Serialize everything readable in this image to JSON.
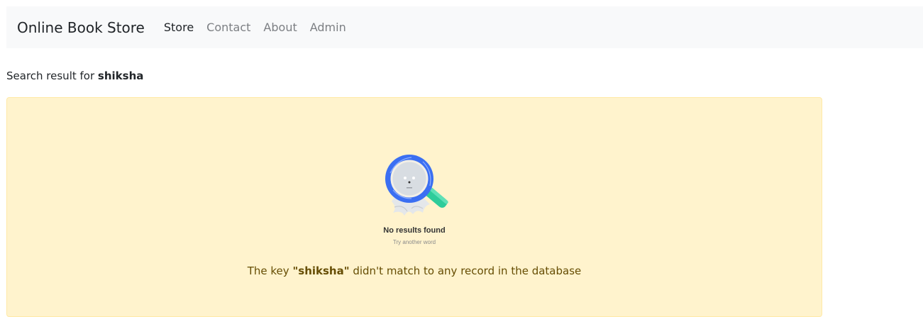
{
  "navbar": {
    "brand": "Online Book Store",
    "links": [
      {
        "label": "Store",
        "active": true
      },
      {
        "label": "Contact",
        "active": false
      },
      {
        "label": "About",
        "active": false
      },
      {
        "label": "Admin",
        "active": false
      }
    ]
  },
  "search": {
    "prefix": "Search result for",
    "query": "shiksha"
  },
  "empty_state": {
    "icon": "magnifier-empty-face-illustration",
    "title": "No results found",
    "subtitle": "Try another word"
  },
  "alert": {
    "prefix": "The key",
    "key_quoted": "\"shiksha\"",
    "suffix": "didn't match to any record in the database"
  },
  "colors": {
    "navbar_bg": "#f8f9fa",
    "alert_bg": "#fff3cd",
    "alert_text": "#664d03",
    "magnifier_ring": "#3b6ff2",
    "magnifier_handle": "#2ecc9a"
  }
}
